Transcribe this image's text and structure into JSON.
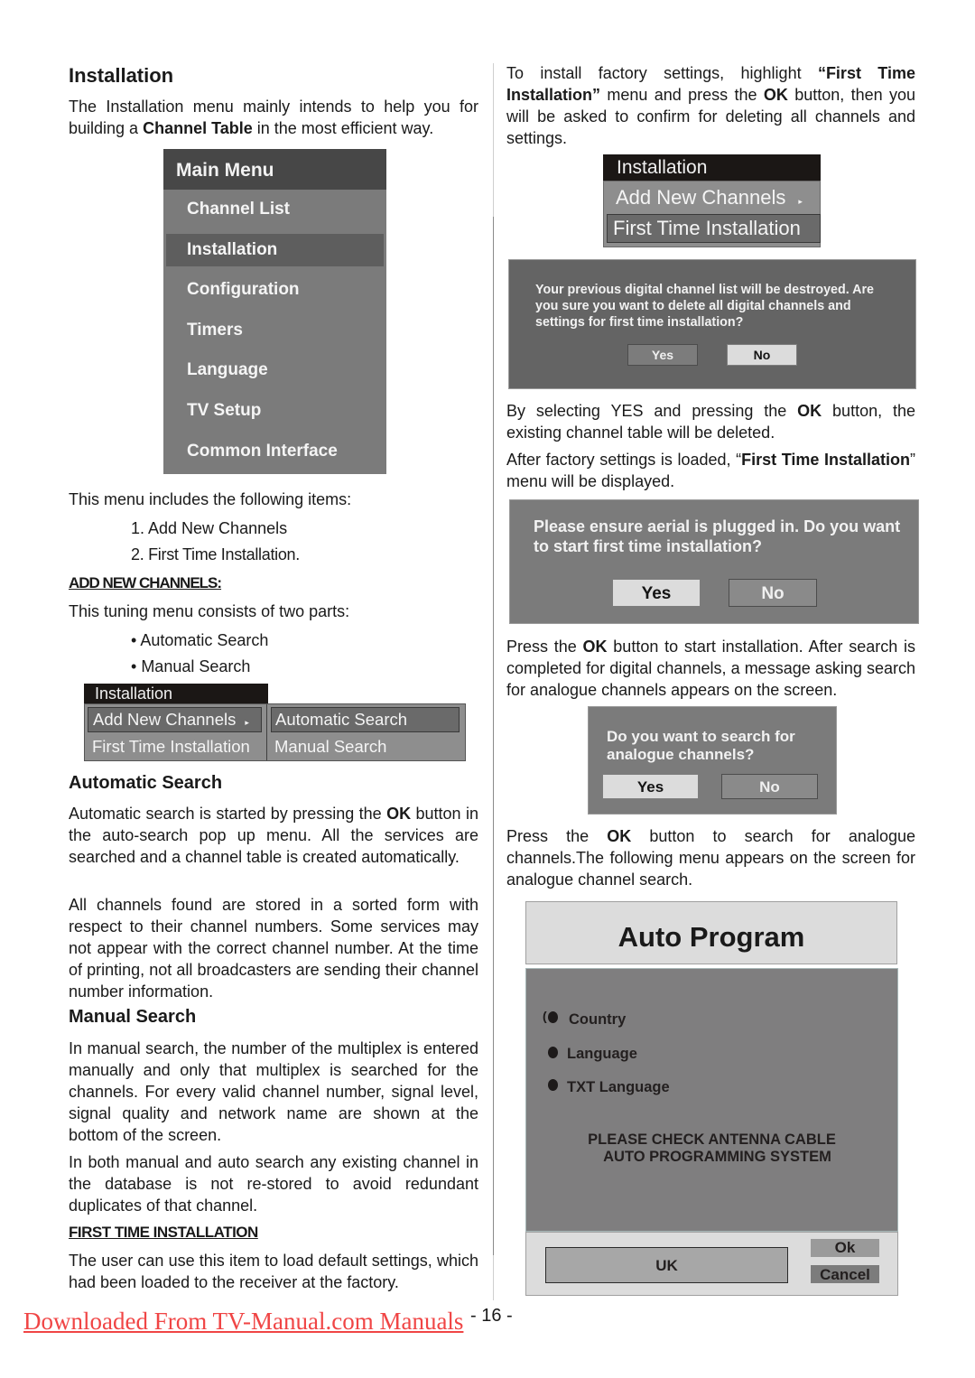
{
  "left": {
    "heading": "Installation",
    "intro_pre": "The Installation menu mainly intends to help you for building a ",
    "intro_bold": "Channel Table",
    "intro_post": " in the most efficient way.",
    "main_menu": {
      "title": "Main Menu",
      "items": [
        "Channel List",
        "Installation",
        "Configuration",
        "Timers",
        "Language",
        "TV Setup",
        "Common Interface"
      ],
      "selected_index": 1
    },
    "includes_text": "This menu includes the following items:",
    "numbered": [
      "1. Add New Channels",
      "2. First Time Installation."
    ],
    "add_new_heading": "ADD NEW CHANNELS:",
    "tuning_text": "This tuning menu consists of two parts:",
    "bullets": [
      "Automatic Search",
      "Manual Search"
    ],
    "install_menu": {
      "title": "Installation",
      "left_items": [
        "Add New Channels",
        "First Time Installation"
      ],
      "right_items": [
        "Automatic Search",
        "Manual Search"
      ],
      "arrow": "▸"
    },
    "auto_heading": "Automatic Search",
    "auto_p1_pre": "Automatic search is started by pressing the ",
    "auto_p1_bold": "OK",
    "auto_p1_post": " button in the auto-search pop up menu. All the services are searched and a channel table is created automatically.",
    "auto_p2": "All channels found are stored in a sorted form with respect to their channel numbers.  Some services may not appear with the correct channel number.  At the time of printing, not all broadcasters are sending their channel number information.",
    "manual_heading": "Manual Search",
    "manual_p1": "In manual search, the number of the multiplex is entered manually and only that multiplex is searched for the channels. For every valid channel number, signal level, signal quality and network name are shown at the bottom of the screen.",
    "manual_p2": "In both manual and auto search any existing channel in the database is not re-stored to avoid redundant duplicates of that channel.",
    "fti_heading": "FIRST TIME INSTALLATION",
    "fti_p": "The user can use this item to load default settings, which had been loaded to the receiver at the factory."
  },
  "right": {
    "p1_pre": "To install factory settings, highlight ",
    "p1_bold1": "“First Time Installation”",
    "p1_mid": " menu and press the ",
    "p1_bold2": "OK",
    "p1_post": " button, then you will be asked to confirm for deleting all channels and settings.",
    "install_menu": {
      "title": "Installation",
      "items": [
        "Add New Channels",
        "First Time Installation"
      ],
      "selected_index": 1,
      "arrow": "▸"
    },
    "dialog1": {
      "message": "Your previous digital channel list will be destroyed. Are you sure you want to delete all digital channels and settings for first time installation?",
      "yes": "Yes",
      "no": "No"
    },
    "p2_pre": "By selecting YES and pressing the ",
    "p2_bold": "OK",
    "p2_post": " button, the existing channel table will be deleted.",
    "p3_pre": "After  factory settings is loaded, “",
    "p3_bold": "First Time Installation",
    "p3_post": "” menu will be displayed.",
    "dialog2": {
      "message": "Please ensure aerial is plugged in. Do you want to start first time installation?",
      "yes": "Yes",
      "no": "No"
    },
    "p4_pre": "Press the ",
    "p4_bold": "OK",
    "p4_post": " button to start installation. After search is completed for digital channels, a message asking search for analogue channels appears on the screen.",
    "dialog3": {
      "message": "Do you want to search for analogue channels?",
      "yes": "Yes",
      "no": "No"
    },
    "p5_pre": "Press the ",
    "p5_bold": "OK",
    "p5_post": " button to search for analogue channels.The following menu appears on the screen for analogue channel search.",
    "auto_program": {
      "title": "Auto Program",
      "items": [
        "Country",
        "Language",
        "TXT Language"
      ],
      "message_line1": "PLEASE CHECK ANTENNA CABLE",
      "message_line2": "AUTO PROGRAMMING SYSTEM",
      "country_value": "UK",
      "ok": "Ok",
      "cancel": "Cancel"
    }
  },
  "footer": {
    "link": "Downloaded From TV-Manual.com Manuals",
    "page_number": "- 16 -"
  },
  "colors": {
    "link": "#f04545",
    "menu_title_bg": "#474747",
    "menu_bg": "#7b7b7b",
    "dialog_bg": "#646464"
  }
}
